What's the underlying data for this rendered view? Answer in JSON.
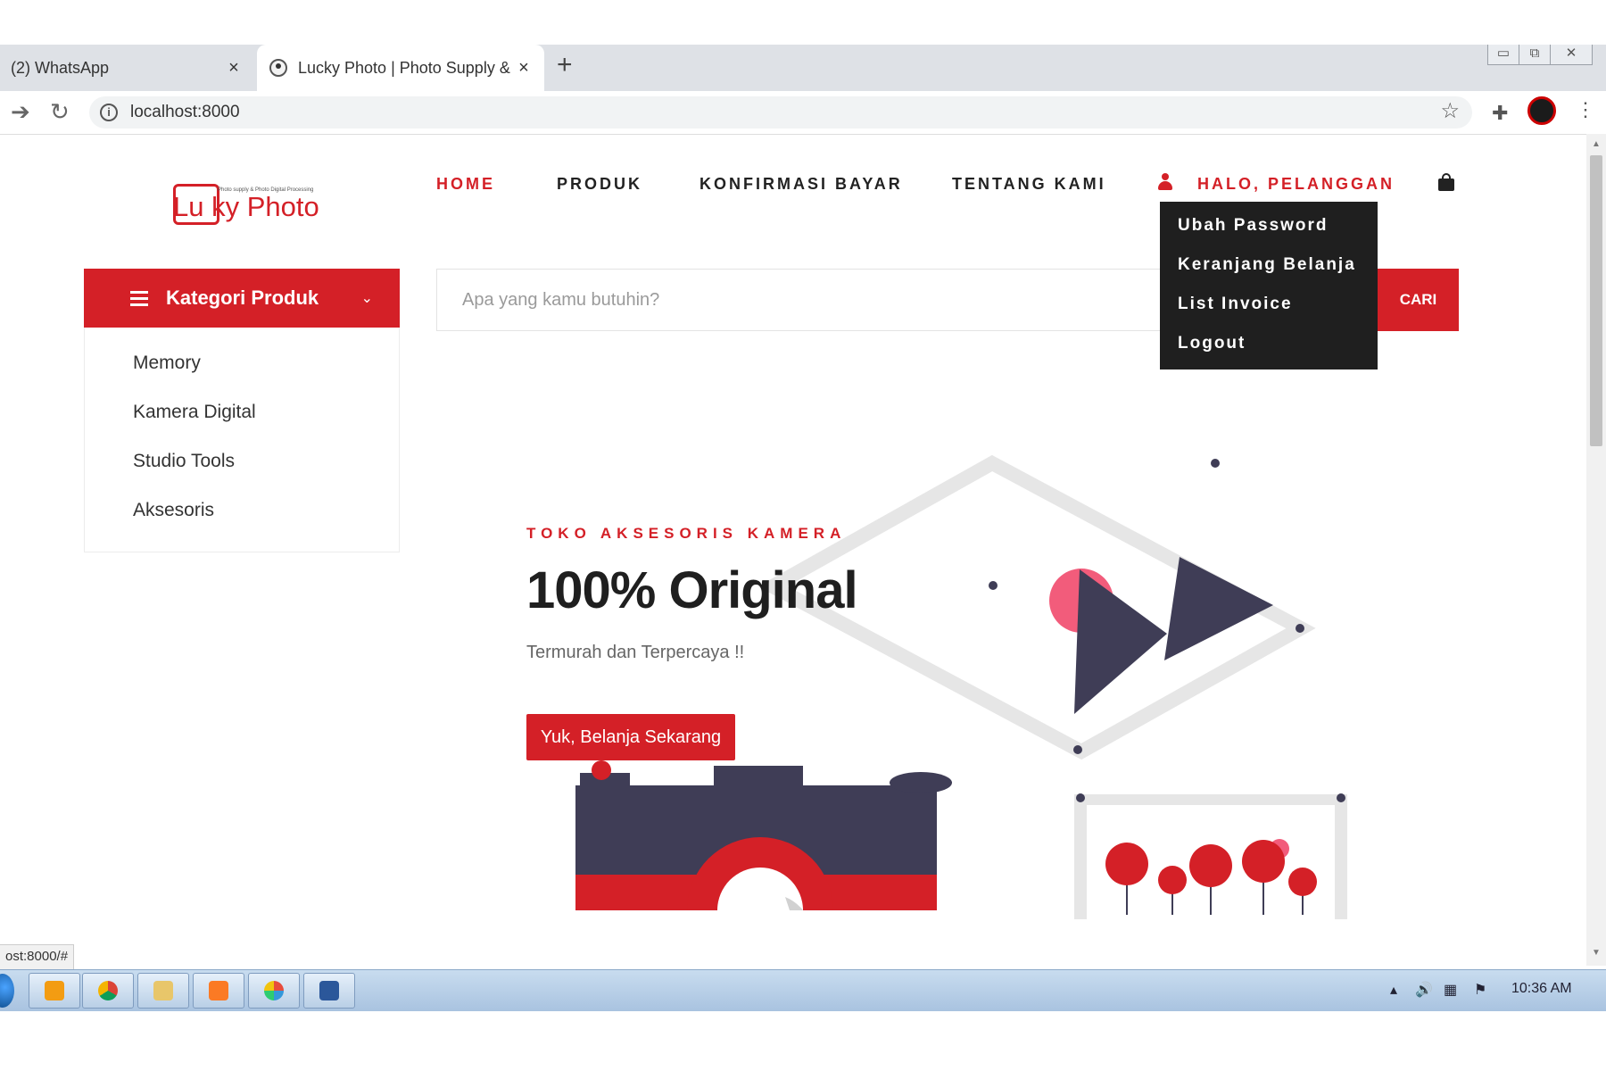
{
  "browser": {
    "tabs": [
      {
        "title": "(2) WhatsApp",
        "active": false
      },
      {
        "title": "Lucky Photo | Photo Supply & Ph",
        "active": true
      }
    ],
    "new_tab": "+",
    "close_glyph": "×",
    "url": "localhost:8000",
    "status_url": "ost:8000/#"
  },
  "site": {
    "logo": {
      "name": "Lu ky Photo",
      "tagline": "Photo supply & Photo Digital Processing"
    },
    "nav": [
      {
        "label": "HOME",
        "active": true
      },
      {
        "label": "PRODUK",
        "active": false
      },
      {
        "label": "KONFIRMASI BAYAR",
        "active": false
      },
      {
        "label": "TENTANG KAMI",
        "active": false
      }
    ],
    "user_greeting": "HALO, PELANGGAN",
    "user_menu": [
      "Ubah Password",
      "Keranjang Belanja",
      "List Invoice",
      "Logout"
    ],
    "categories": {
      "title": "Kategori Produk",
      "items": [
        "Memory",
        "Kamera Digital",
        "Studio Tools",
        "Aksesoris"
      ]
    },
    "search": {
      "placeholder": "Apa yang kamu butuhin?",
      "button": "CARI"
    },
    "hero": {
      "tag": "TOKO AKSESORIS KAMERA",
      "title": "100% Original",
      "subtitle": "Termurah dan Terpercaya !!",
      "cta": "Yuk, Belanja Sekarang"
    }
  },
  "taskbar": {
    "clock": "10:36 AM"
  },
  "colors": {
    "accent": "#d42027",
    "dark": "#3f3d56",
    "dropdown_bg": "#1f1f1f",
    "pink": "#f25c7b"
  },
  "icons": [
    "back-icon",
    "reload-icon",
    "info-icon",
    "star-icon",
    "extensions-icon",
    "profile-icon",
    "kebab-menu-icon",
    "hamburger-icon",
    "chevron-down-icon",
    "user-icon",
    "shopping-bag-icon"
  ]
}
